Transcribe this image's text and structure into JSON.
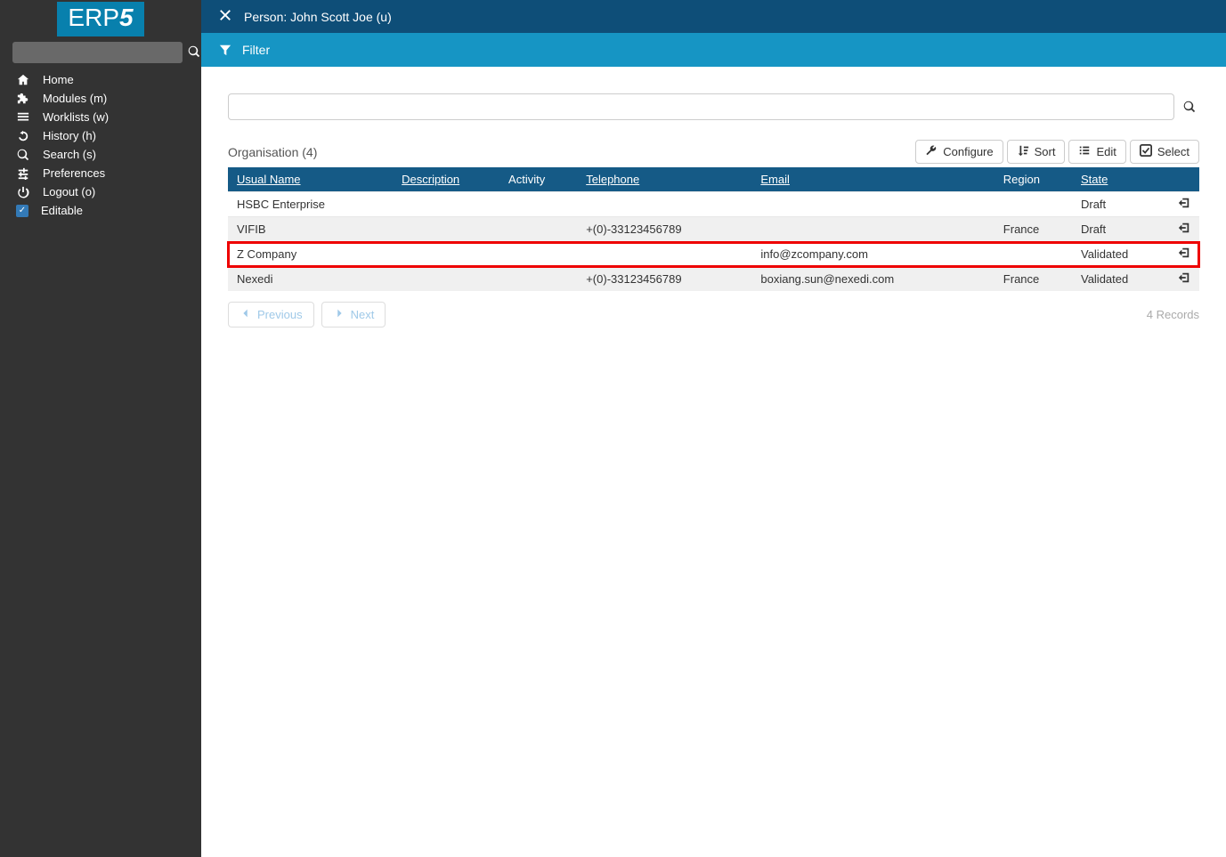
{
  "logo": {
    "text": "ERP",
    "suffix": "5"
  },
  "sidebar": {
    "search": {
      "placeholder": ""
    },
    "items": [
      {
        "label": "Home",
        "icon": "home"
      },
      {
        "label": "Modules (m)",
        "icon": "puzzle"
      },
      {
        "label": "Worklists (w)",
        "icon": "list"
      },
      {
        "label": "History (h)",
        "icon": "history"
      },
      {
        "label": "Search (s)",
        "icon": "search"
      },
      {
        "label": "Preferences",
        "icon": "sliders"
      },
      {
        "label": "Logout (o)",
        "icon": "power"
      }
    ],
    "editable": {
      "label": "Editable",
      "checked": true
    }
  },
  "header": {
    "title": "Person: John Scott Joe (u)"
  },
  "filter": {
    "label": "Filter"
  },
  "search_bar": {
    "placeholder": ""
  },
  "table": {
    "title": "Organisation (4)",
    "actions": {
      "configure": "Configure",
      "sort": "Sort",
      "edit": "Edit",
      "select": "Select"
    },
    "columns": [
      {
        "label": "Usual Name",
        "sortable": true
      },
      {
        "label": "Description",
        "sortable": true
      },
      {
        "label": "Activity",
        "sortable": false
      },
      {
        "label": "Telephone",
        "sortable": true
      },
      {
        "label": "Email",
        "sortable": true
      },
      {
        "label": "Region",
        "sortable": false
      },
      {
        "label": "State",
        "sortable": true
      }
    ],
    "rows": [
      {
        "usual_name": "HSBC Enterprise",
        "description": "",
        "activity": "",
        "telephone": "",
        "email": "",
        "region": "",
        "state": "Draft",
        "highlighted": false
      },
      {
        "usual_name": "VIFIB",
        "description": "",
        "activity": "",
        "telephone": "+(0)-33123456789",
        "email": "",
        "region": "France",
        "state": "Draft",
        "highlighted": false
      },
      {
        "usual_name": "Z Company",
        "description": "",
        "activity": "",
        "telephone": "",
        "email": "info@zcompany.com",
        "region": "",
        "state": "Validated",
        "highlighted": true
      },
      {
        "usual_name": "Nexedi",
        "description": "",
        "activity": "",
        "telephone": "+(0)-33123456789",
        "email": "boxiang.sun@nexedi.com",
        "region": "France",
        "state": "Validated",
        "highlighted": false
      }
    ],
    "pager": {
      "previous": "Previous",
      "next": "Next"
    },
    "records_label": "4 Records"
  }
}
